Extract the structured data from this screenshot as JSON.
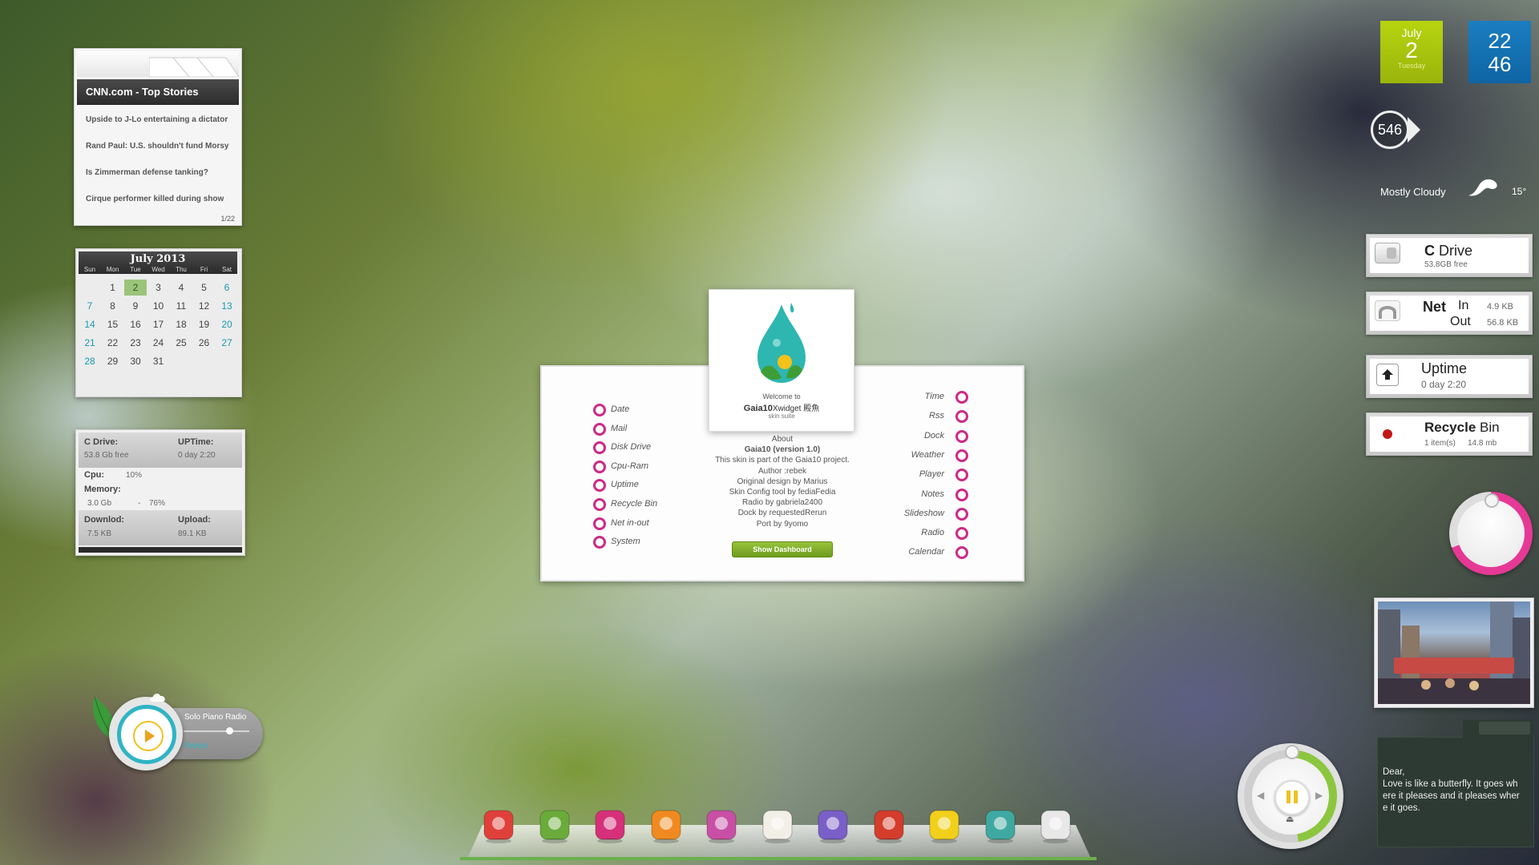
{
  "rss": {
    "title": "CNN.com - Top Stories",
    "items": [
      "Upside to J-Lo entertaining a dictator",
      "Rand Paul: U.S. shouldn't fund Morsy",
      "Is Zimmerman defense tanking?",
      "Cirque performer killed during show"
    ],
    "pager": "1/22"
  },
  "calendar": {
    "title": "July 2013",
    "weekdays": [
      "Sun",
      "Mon",
      "Tue",
      "Wed",
      "Thu",
      "Fri",
      "Sat"
    ],
    "today": 2,
    "first_weekday": 1,
    "days_in_month": 31
  },
  "system": {
    "c_drive_label": "C Drive:",
    "c_drive_value": "53.8 Gb free",
    "uptime_label": "UPTime:",
    "uptime_value": "0 day 2:20",
    "cpu_label": "Cpu:",
    "cpu_value": "10%",
    "memory_label": "Memory:",
    "memory_value": "3.0 Gb",
    "memory_sep": "-",
    "memory_pct": "76%",
    "download_label": "Downlod:",
    "download_value": "7.5 KB",
    "upload_label": "Upload:",
    "upload_value": "89.1 KB"
  },
  "player": {
    "station": "Solo Piano Radio",
    "status": "Ready",
    "volume": 0.7
  },
  "welcome": {
    "line1": "Welcome to",
    "brand": "Gaia10",
    "brand_suffix": "Xwidget 殿魚",
    "line3": "skin suite",
    "left_options": [
      "Date",
      "Mail",
      "Disk Drive",
      "Cpu-Ram",
      "Uptime",
      "Recycle Bin",
      "Net in-out",
      "System"
    ],
    "right_options": [
      "Time",
      "Rss",
      "Dock",
      "Weather",
      "Player",
      "Notes",
      "Slideshow",
      "Radio",
      "Calendar"
    ],
    "about": [
      "About",
      "Gaia10 (version 1.0)",
      "This skin is part of the Gaia10 project.",
      "Author :rebek",
      "Original design by Marius",
      "Skin Config tool by fediaFedia",
      "Radio by gabriela2400",
      "Dock by requestedRerun",
      "Port by 9yomo"
    ],
    "button": "Show Dashboard"
  },
  "date_tile": {
    "month": "July",
    "day": "2",
    "weekday": "Tuesday"
  },
  "time_tile": {
    "hour": "22",
    "minute": "46"
  },
  "badge": {
    "count": "546"
  },
  "weather": {
    "condition": "Mostly Cloudy",
    "temp": "15°"
  },
  "drive": {
    "label_c": "C",
    "label": "Drive",
    "free": "53.8GB free"
  },
  "net": {
    "label": "Net",
    "in_label": "In",
    "out_label": "Out",
    "in_value": "4.9 KB",
    "out_value": "56.8 KB"
  },
  "uptime": {
    "label": "Uptime",
    "value": "0 day 2:20"
  },
  "recycle": {
    "label": "Recycle",
    "label2": "Bin",
    "items": "1 item(s)",
    "size": "14.8 mb"
  },
  "note": {
    "lines": [
      "Dear,",
      "Love is like a butterfly. It goes wh",
      "ere it pleases and it pleases wher",
      "e it goes."
    ]
  },
  "dock": {
    "icons": [
      "notes-icon",
      "music-icon",
      "video-icon",
      "fire-icon",
      "plant-icon",
      "egg-icon",
      "chat-icon",
      "mail-icon",
      "tv-icon",
      "avatar-icon",
      "trash-icon"
    ],
    "colors": [
      "#e0403a",
      "#6aab3a",
      "#d6307a",
      "#f08a20",
      "#c84fa5",
      "#f2efe6",
      "#7a5fc8",
      "#d43c2c",
      "#f2d01a",
      "#3fa9a1",
      "#e8e8e8"
    ]
  }
}
